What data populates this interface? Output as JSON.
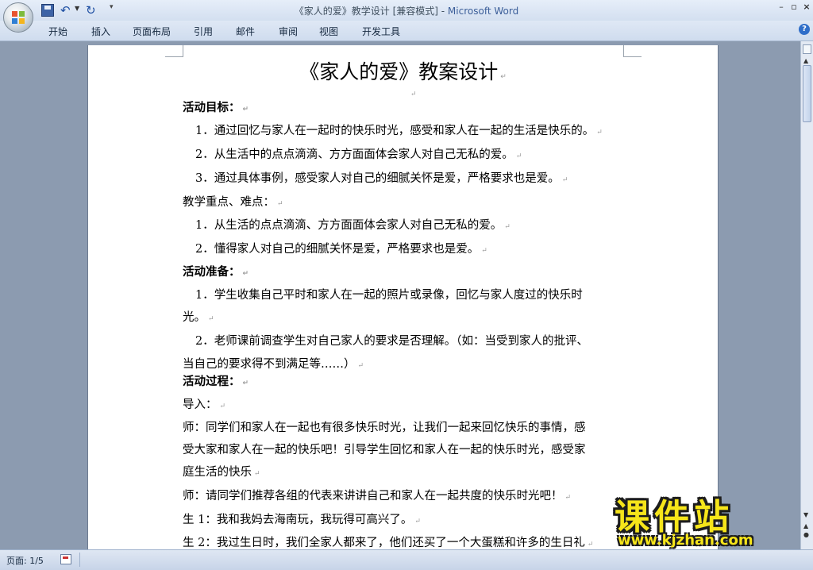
{
  "window": {
    "doc_name": "《家人的爱》教学设计 [兼容模式] - ",
    "app_name": "Microsoft Word"
  },
  "ribbon_tabs": [
    "开始",
    "插入",
    "页面布局",
    "引用",
    "邮件",
    "审阅",
    "视图",
    "开发工具"
  ],
  "document": {
    "title": "《家人的爱》教案设计",
    "lines": [
      {
        "text": "活动目标：",
        "bold": true
      },
      {
        "text": "1．通过回忆与家人在一起时的快乐时光，感受和家人在一起的生活是快乐的。",
        "bold": false
      },
      {
        "text": "2．从生活中的点点滴滴、方方面面体会家人对自己无私的爱。",
        "bold": false
      },
      {
        "text": "3．通过具体事例，感受家人对自己的细腻关怀是爱，严格要求也是爱。",
        "bold": false
      },
      {
        "text": "教学重点、难点：",
        "bold": false
      },
      {
        "text": "1．从生活的点点滴滴、方方面面体会家人对自己无私的爱。",
        "bold": false
      },
      {
        "text": "2．懂得家人对自己的细腻关怀是爱，严格要求也是爱。",
        "bold": false
      },
      {
        "text": "活动准备：",
        "bold": true
      },
      {
        "text": "1．学生收集自己平时和家人在一起的照片或录像，回忆与家人度过的快乐时",
        "bold": false
      },
      {
        "text": "光。",
        "bold": false
      },
      {
        "text": "2．老师课前调查学生对自己家人的要求是否理解。（如：当受到家人的批评、",
        "bold": false
      },
      {
        "text": "当自己的要求得不到满足等……）",
        "bold": false
      },
      {
        "text": "活动过程：",
        "bold": true
      },
      {
        "text": "导入：",
        "bold": false
      },
      {
        "text": "师：同学们和家人在一起也有很多快乐时光，让我们一起来回忆快乐的事情，感",
        "bold": false
      },
      {
        "text": "受大家和家人在一起的快乐吧！引导学生回忆和家人在一起的快乐时光，感受家",
        "bold": false
      },
      {
        "text": "庭生活的快乐",
        "bold": false
      },
      {
        "text": "师：请同学们推荐各组的代表来讲讲自己和家人在一起共度的快乐时光吧！",
        "bold": false
      },
      {
        "text": "生 1：我和我妈去海南玩，我玩得可高兴了。",
        "bold": false
      },
      {
        "text": "生 2：我过生日时，我们全家人都来了，他们还买了一个大蛋糕和许多的生日礼",
        "bold": false
      }
    ],
    "paragraph_mark": "↵"
  },
  "watermark": {
    "text": "课件站",
    "url": "www.kjzhan.com"
  },
  "status_bar": {
    "page": "页面: 1/5"
  },
  "colors": {
    "title_app": "#3b5e99",
    "watermark_fill": "#f6e51a"
  }
}
